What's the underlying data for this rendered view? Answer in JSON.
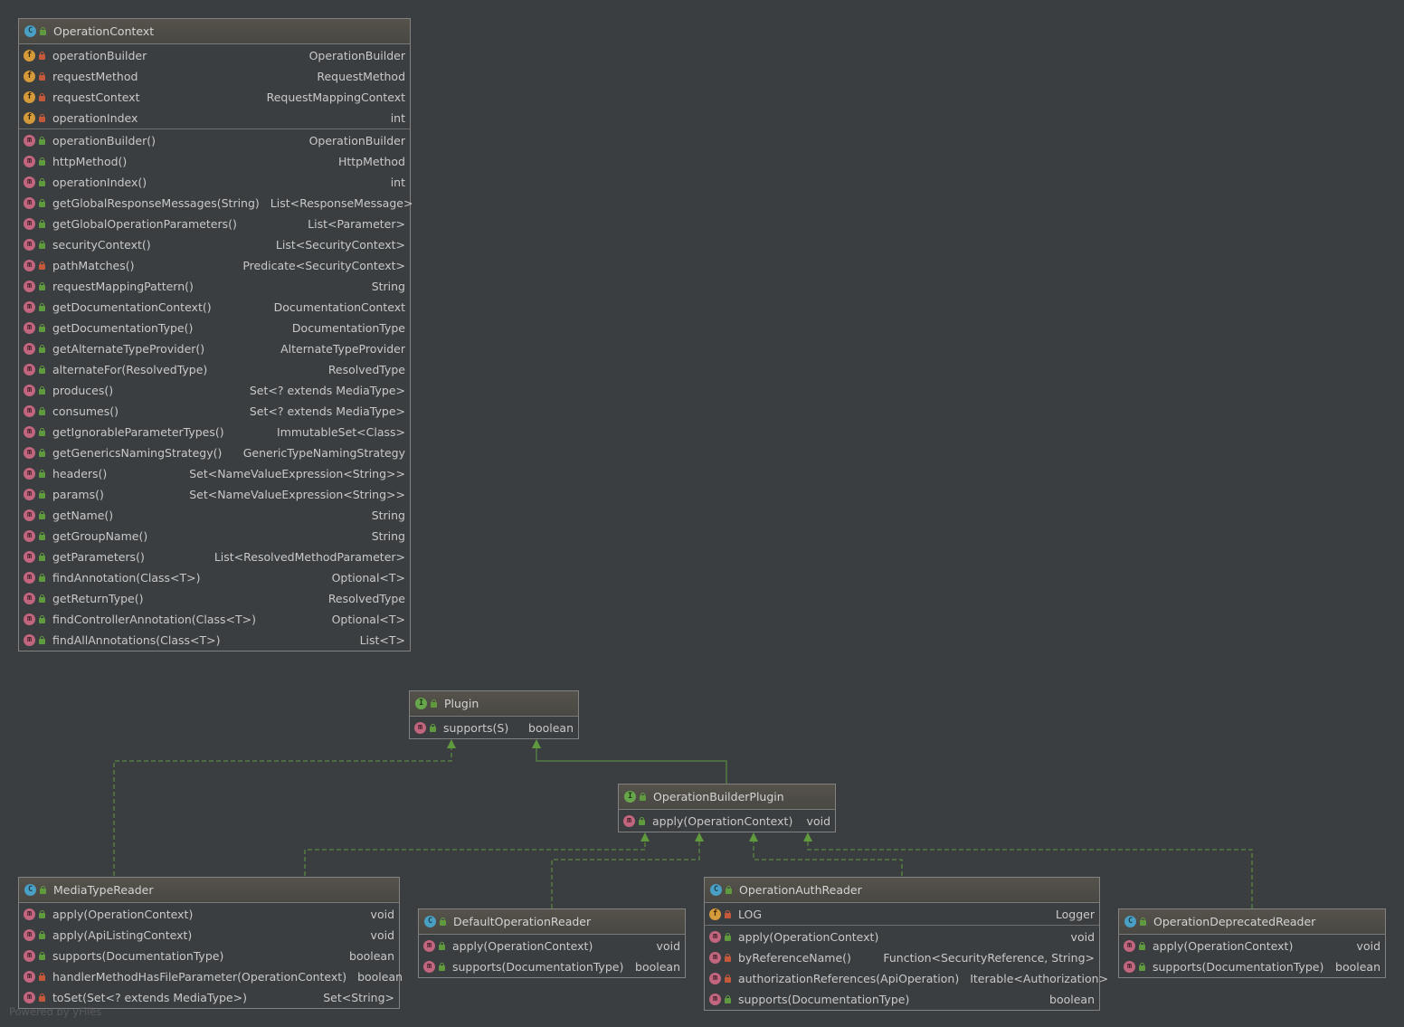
{
  "diagram": {
    "watermark": "Powered by yFiles",
    "classes": {
      "operation_context": {
        "kind": "C",
        "name": "OperationContext",
        "fields": [
          {
            "name": "operationBuilder",
            "type": "OperationBuilder"
          },
          {
            "name": "requestMethod",
            "type": "RequestMethod"
          },
          {
            "name": "requestContext",
            "type": "RequestMappingContext"
          },
          {
            "name": "operationIndex",
            "type": "int"
          }
        ],
        "methods": [
          {
            "name": "operationBuilder()",
            "type": "OperationBuilder",
            "vis": "public"
          },
          {
            "name": "httpMethod()",
            "type": "HttpMethod",
            "vis": "public"
          },
          {
            "name": "operationIndex()",
            "type": "int",
            "vis": "public"
          },
          {
            "name": "getGlobalResponseMessages(String)",
            "type": "List<ResponseMessage>",
            "vis": "public"
          },
          {
            "name": "getGlobalOperationParameters()",
            "type": "List<Parameter>",
            "vis": "public"
          },
          {
            "name": "securityContext()",
            "type": "List<SecurityContext>",
            "vis": "public"
          },
          {
            "name": "pathMatches()",
            "type": "Predicate<SecurityContext>",
            "vis": "private"
          },
          {
            "name": "requestMappingPattern()",
            "type": "String",
            "vis": "public"
          },
          {
            "name": "getDocumentationContext()",
            "type": "DocumentationContext",
            "vis": "public"
          },
          {
            "name": "getDocumentationType()",
            "type": "DocumentationType",
            "vis": "public"
          },
          {
            "name": "getAlternateTypeProvider()",
            "type": "AlternateTypeProvider",
            "vis": "public"
          },
          {
            "name": "alternateFor(ResolvedType)",
            "type": "ResolvedType",
            "vis": "public"
          },
          {
            "name": "produces()",
            "type": "Set<? extends MediaType>",
            "vis": "public"
          },
          {
            "name": "consumes()",
            "type": "Set<? extends MediaType>",
            "vis": "public"
          },
          {
            "name": "getIgnorableParameterTypes()",
            "type": "ImmutableSet<Class>",
            "vis": "public"
          },
          {
            "name": "getGenericsNamingStrategy()",
            "type": "GenericTypeNamingStrategy",
            "vis": "public"
          },
          {
            "name": "headers()",
            "type": "Set<NameValueExpression<String>>",
            "vis": "public"
          },
          {
            "name": "params()",
            "type": "Set<NameValueExpression<String>>",
            "vis": "public"
          },
          {
            "name": "getName()",
            "type": "String",
            "vis": "public"
          },
          {
            "name": "getGroupName()",
            "type": "String",
            "vis": "public"
          },
          {
            "name": "getParameters()",
            "type": "List<ResolvedMethodParameter>",
            "vis": "public"
          },
          {
            "name": "findAnnotation(Class<T>)",
            "type": "Optional<T>",
            "vis": "public"
          },
          {
            "name": "getReturnType()",
            "type": "ResolvedType",
            "vis": "public"
          },
          {
            "name": "findControllerAnnotation(Class<T>)",
            "type": "Optional<T>",
            "vis": "public"
          },
          {
            "name": "findAllAnnotations(Class<T>)",
            "type": "List<T>",
            "vis": "public"
          }
        ]
      },
      "plugin": {
        "kind": "I",
        "name": "Plugin",
        "methods": [
          {
            "name": "supports(S)",
            "type": "boolean",
            "vis": "public"
          }
        ]
      },
      "operation_builder_plugin": {
        "kind": "I",
        "name": "OperationBuilderPlugin",
        "methods": [
          {
            "name": "apply(OperationContext)",
            "type": "void",
            "vis": "public"
          }
        ]
      },
      "media_type_reader": {
        "kind": "C",
        "name": "MediaTypeReader",
        "methods": [
          {
            "name": "apply(OperationContext)",
            "type": "void",
            "vis": "public"
          },
          {
            "name": "apply(ApiListingContext)",
            "type": "void",
            "vis": "public"
          },
          {
            "name": "supports(DocumentationType)",
            "type": "boolean",
            "vis": "public"
          },
          {
            "name": "handlerMethodHasFileParameter(OperationContext)",
            "type": "boolean",
            "vis": "private"
          },
          {
            "name": "toSet(Set<? extends MediaType>)",
            "type": "Set<String>",
            "vis": "private"
          }
        ]
      },
      "default_operation_reader": {
        "kind": "C",
        "name": "DefaultOperationReader",
        "methods": [
          {
            "name": "apply(OperationContext)",
            "type": "void",
            "vis": "public"
          },
          {
            "name": "supports(DocumentationType)",
            "type": "boolean",
            "vis": "public"
          }
        ]
      },
      "operation_auth_reader": {
        "kind": "C",
        "name": "OperationAuthReader",
        "fields": [
          {
            "name": "LOG",
            "type": "Logger"
          }
        ],
        "methods": [
          {
            "name": "apply(OperationContext)",
            "type": "void",
            "vis": "public"
          },
          {
            "name": "byReferenceName()",
            "type": "Function<SecurityReference, String>",
            "vis": "private"
          },
          {
            "name": "authorizationReferences(ApiOperation)",
            "type": "Iterable<Authorization>",
            "vis": "private"
          },
          {
            "name": "supports(DocumentationType)",
            "type": "boolean",
            "vis": "public"
          }
        ]
      },
      "operation_deprecated_reader": {
        "kind": "C",
        "name": "OperationDeprecatedReader",
        "methods": [
          {
            "name": "apply(OperationContext)",
            "type": "void",
            "vis": "public"
          },
          {
            "name": "supports(DocumentationType)",
            "type": "boolean",
            "vis": "public"
          }
        ]
      }
    },
    "colors": {
      "background": "#3b3e40",
      "arrow": "#5f9a3f",
      "class_icon": "#4a9fc4",
      "interface_icon": "#68a64b",
      "method_icon": "#c2657e",
      "field_icon": "#d59a3a"
    }
  }
}
